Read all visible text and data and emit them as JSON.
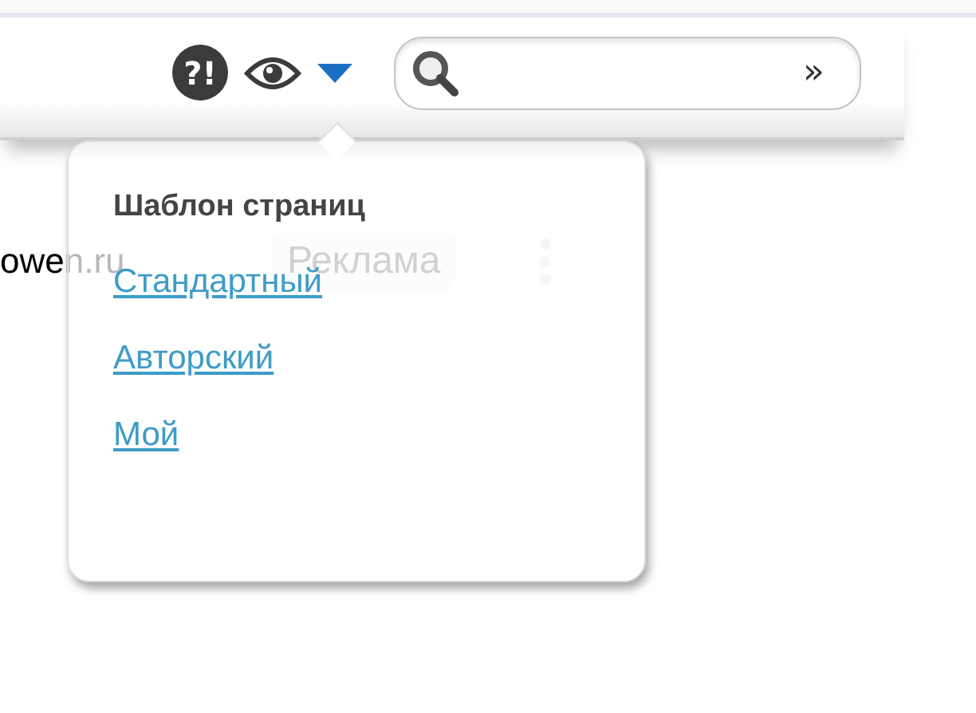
{
  "toolbar": {
    "help_glyph": "?!",
    "search": {
      "submit_glyph": "»"
    }
  },
  "page": {
    "site_text": "owen.ru",
    "ad_label": "Реклама"
  },
  "template_menu": {
    "title": "Шаблон страниц",
    "items": [
      {
        "label": "Стандартный"
      },
      {
        "label": "Авторский"
      },
      {
        "label": "Мой"
      }
    ]
  }
}
